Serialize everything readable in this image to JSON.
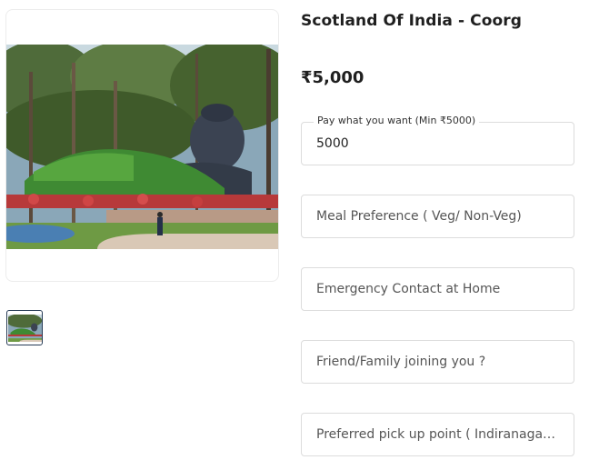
{
  "product": {
    "title": "Scotland Of India - Coorg",
    "price": "₹5,000",
    "image_alt": "Shiva statue in garden park"
  },
  "form": {
    "pay_what_you_want": {
      "label": "Pay what you want (Min ₹5000)",
      "value": "5000"
    },
    "meal_preference": {
      "placeholder": "Meal Preference ( Veg/ Non-Veg)"
    },
    "emergency_contact": {
      "placeholder": "Emergency Contact at Home"
    },
    "friend_family": {
      "placeholder": "Friend/Family joining you ?"
    },
    "pickup_point": {
      "placeholder": "Preferred pick up point ( Indiranagar / Koramangala )"
    }
  }
}
